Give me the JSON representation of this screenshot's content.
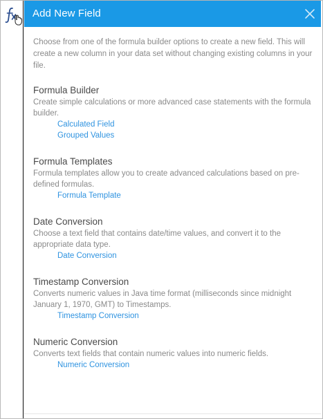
{
  "header": {
    "title": "Add New Field"
  },
  "intro": "Choose from one of the formula builder options to create a new field. This will create a new column in your data set without changing existing columns in your file.",
  "sections": [
    {
      "title": "Formula Builder",
      "description": "Create simple calculations or more advanced case statements with the formula builder.",
      "links": [
        "Calculated Field",
        "Grouped Values"
      ]
    },
    {
      "title": "Formula Templates",
      "description": "Formula templates allow you to create advanced calculations based on pre-defined formulas.",
      "links": [
        "Formula Template"
      ]
    },
    {
      "title": "Date Conversion",
      "description": "Choose a text field that contains date/time values, and convert it to the appropriate data type.",
      "links": [
        "Date Conversion"
      ]
    },
    {
      "title": "Timestamp Conversion",
      "description": "Converts numeric values in Java time format (milliseconds since midnight January 1, 1970, GMT) to Timestamps.",
      "links": [
        "Timestamp Conversion"
      ]
    },
    {
      "title": "Numeric Conversion",
      "description": "Converts text fields that contain numeric values into numeric fields.",
      "links": [
        "Numeric Conversion"
      ]
    }
  ],
  "icons": {
    "formula": "fx-icon",
    "close": "close-icon"
  },
  "colors": {
    "header_bg": "#1a99e6",
    "link": "#2f93e0",
    "body_text": "#8a8a8a",
    "section_title": "#4a4a4a"
  }
}
